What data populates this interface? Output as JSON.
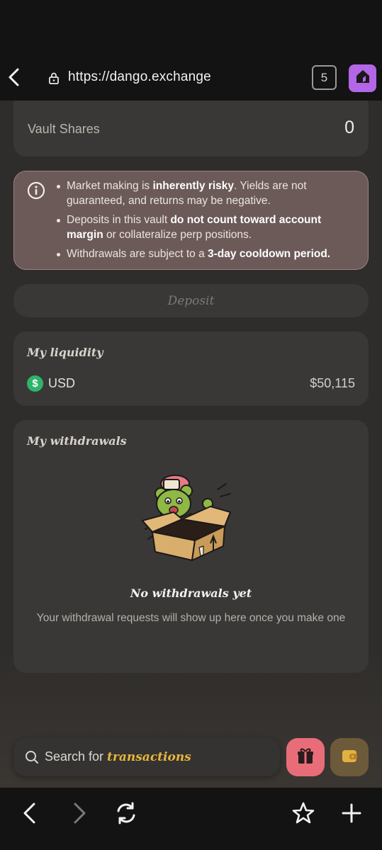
{
  "browser": {
    "url": "https://dango.exchange",
    "tab_count": "5"
  },
  "vault": {
    "label": "Vault Shares",
    "value": "0"
  },
  "warning": {
    "item1_pre": "Market making is ",
    "item1_bold": "inherently risky",
    "item1_post": ". Yields are not guaranteed, and returns may be negative.",
    "item2_pre": "Deposits in this vault ",
    "item2_bold": "do not count toward account margin",
    "item2_post": " or collateralize perp positions.",
    "item3_pre": "Withdrawals are subject to a ",
    "item3_bold": "3-day cooldown period."
  },
  "deposit_label": "Deposit",
  "liquidity": {
    "title": "My liquidity",
    "currency_icon": "$",
    "currency": "USD",
    "amount": "$50,115"
  },
  "withdrawals": {
    "title": "My withdrawals",
    "empty_title": "No withdrawals yet",
    "empty_desc": "Your withdrawal requests will show up here once you make one"
  },
  "search": {
    "prefix": "Search for ",
    "emphasis": "transactions"
  },
  "colors": {
    "accent_purple": "#b366e6",
    "warning_bg": "#6b5a58",
    "gift_bg": "#e86d78",
    "wallet_bg": "#6d5a3a",
    "highlight_yellow": "#e8b63c",
    "usd_green": "#2fb36b"
  },
  "icons": [
    "back-arrow-icon",
    "lock-icon",
    "home-icon",
    "info-icon",
    "dollar-icon",
    "search-icon",
    "gift-icon",
    "wallet-icon",
    "nav-back-icon",
    "nav-forward-icon",
    "refresh-icon",
    "star-icon",
    "plus-icon"
  ]
}
